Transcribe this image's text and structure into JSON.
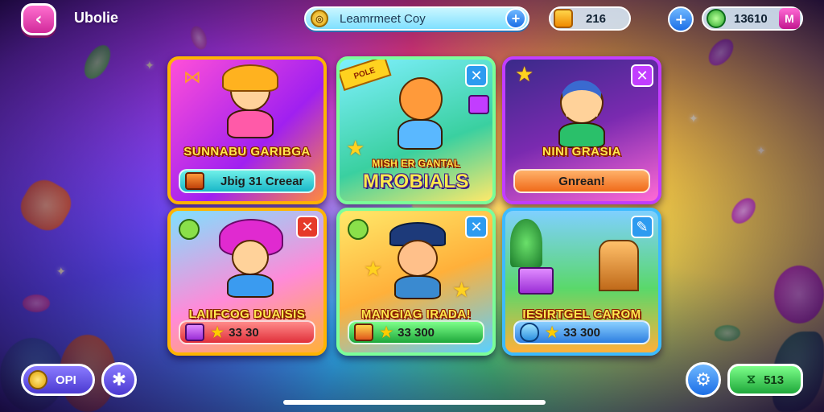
{
  "header": {
    "title": "Ubolie",
    "back_icon": "chevron-left-icon",
    "search_label": "Leamrmeet Coy",
    "gift_value": "216",
    "gems_value": "13610",
    "gems_badge": "M"
  },
  "cards": [
    {
      "title": "SUNNABU GARIBGA",
      "button": "Jbig 31 Creear",
      "border": "#ffb400"
    },
    {
      "title_top": "MISH ER GANTAL",
      "title": "MROBIALS",
      "ribbon": "POLE",
      "border": "#7cff9a"
    },
    {
      "title": "NINI GRASIA",
      "button": "Gnrean!",
      "border": "#c23dff"
    },
    {
      "title": "LAIIFCOG DUAISIS",
      "button_star": "★",
      "button": "33 30",
      "border": "#ffb400"
    },
    {
      "title": "MANGIAG IRADA!",
      "button_star": "★",
      "button": "33 300",
      "border": "#7cff9a"
    },
    {
      "title": "IESIRTGEL CAROM",
      "button_star": "★",
      "button": "33 300",
      "border": "#3dbbff"
    }
  ],
  "footer": {
    "opt_label": "OPI",
    "score_label": "513"
  },
  "colors": {
    "accent_pink": "#d12a9a",
    "accent_blue": "#1b6ee6",
    "accent_green": "#1ea73a"
  }
}
